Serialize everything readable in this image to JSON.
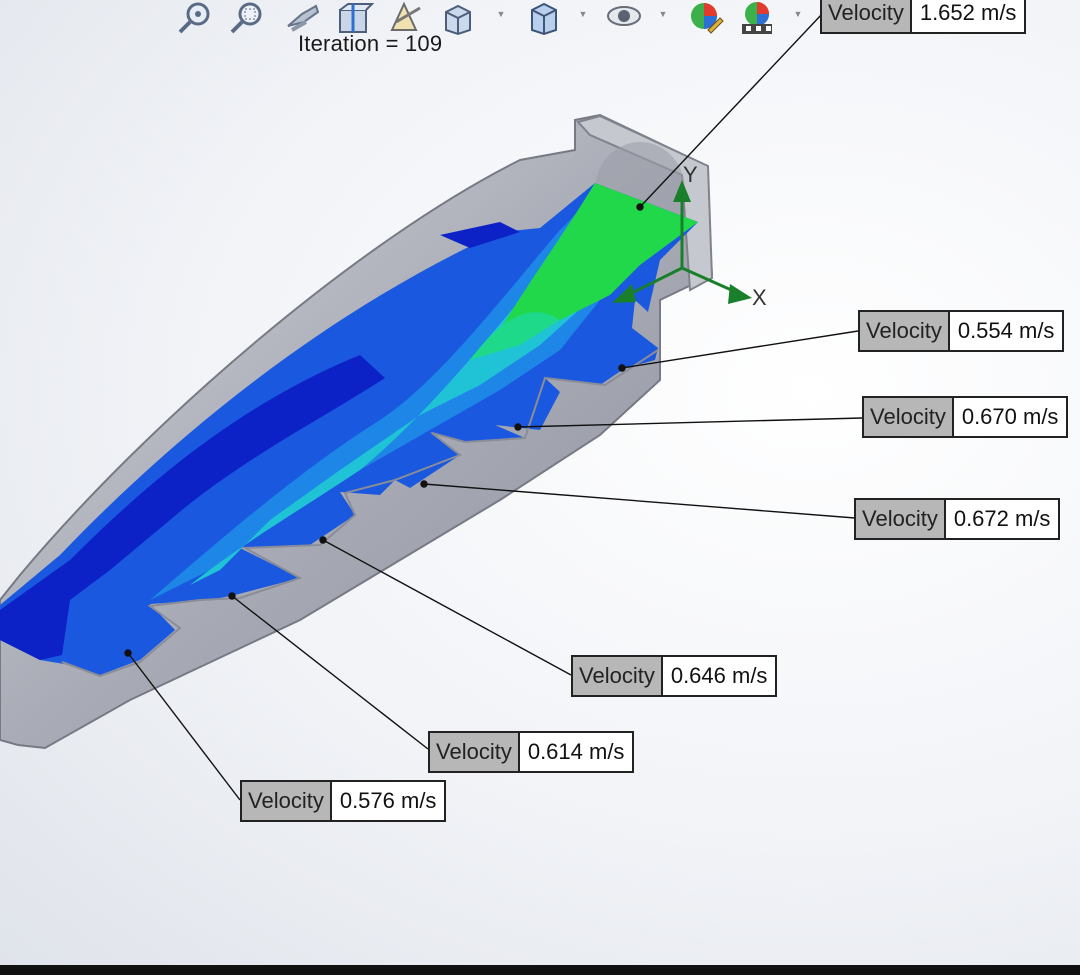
{
  "toolbar": {
    "icons": [
      "zoom-to-fit-icon",
      "zoom-to-area-icon",
      "previous-view-icon",
      "section-view-icon",
      "dynamic-annotation-icon",
      "view-orientation-icon",
      "display-style-icon",
      "hide-show-items-icon",
      "edit-appearance-icon",
      "apply-scene-icon"
    ]
  },
  "iteration": {
    "label": "Iteration = 109"
  },
  "axes": {
    "x": "X",
    "y": "Y"
  },
  "probes": [
    {
      "id": "p1",
      "name": "Velocity",
      "value": "1.652 m/s"
    },
    {
      "id": "p2",
      "name": "Velocity",
      "value": "0.554 m/s"
    },
    {
      "id": "p3",
      "name": "Velocity",
      "value": "0.670 m/s"
    },
    {
      "id": "p4",
      "name": "Velocity",
      "value": "0.672 m/s"
    },
    {
      "id": "p5",
      "name": "Velocity",
      "value": "0.646 m/s"
    },
    {
      "id": "p6",
      "name": "Velocity",
      "value": "0.614 m/s"
    },
    {
      "id": "p7",
      "name": "Velocity",
      "value": "0.576 m/s"
    }
  ],
  "colors": {
    "very_low": "#0b1fc4",
    "low": "#1754e0",
    "mid_low": "#1e86e6",
    "mid": "#20c3d6",
    "mid_high": "#1fd98a",
    "high": "#20d84a",
    "housing": "#b9bcc6",
    "triad": "#1a7f2a"
  }
}
